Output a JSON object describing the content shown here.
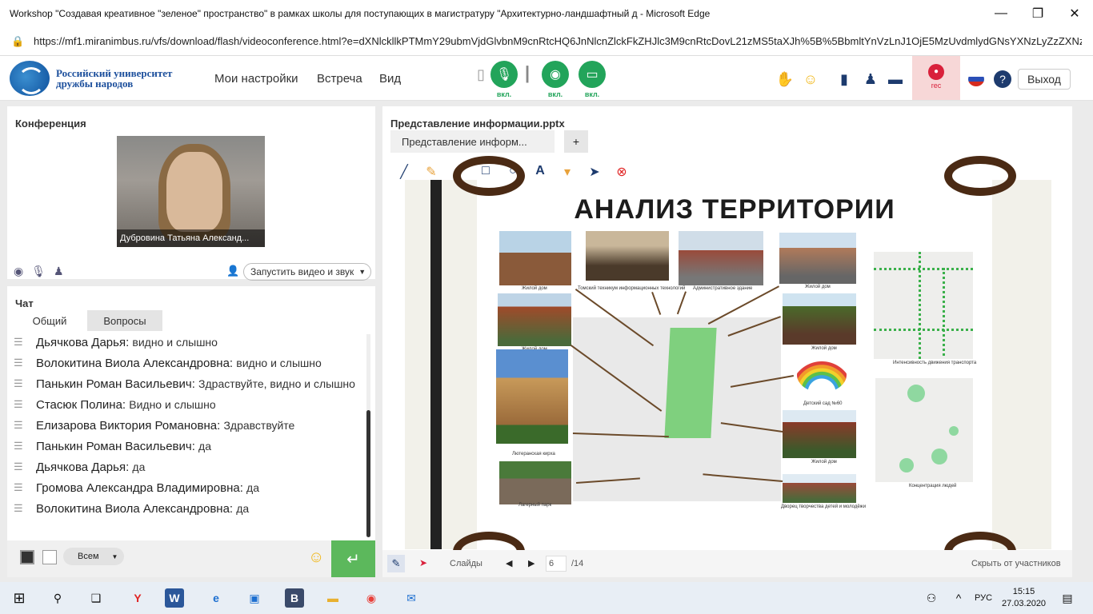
{
  "window": {
    "title": "Workshop \"Создавая креативное \"зеленое\" пространство\" в рамках школы для поступающих в магистратуру \"Архитектурно-ландшафтный д - Microsoft Edge",
    "url": "https://mf1.miranimbus.ru/vfs/download/flash/videoconference.html?e=dXNlckllkPTMmY29ubmVjdGlvbnM9cnRtcHQ6JnNlcnZlckFkZHJlc3M9cnRtcDovL21zMS5taXJh%5B%5BbmltYnVzLnJ1OjE5MzUvdmlydGNsYXNzLyZzZXNzaW9uS"
  },
  "app": {
    "logo_line1": "Российский университет",
    "logo_line2": "дружбы народов",
    "menu": [
      "Мои настройки",
      "Встреча",
      "Вид"
    ],
    "mic_label": "вкл.",
    "cam_label": "вкл.",
    "screen_label": "вкл.",
    "rec_label": "rec",
    "exit_label": "Выход"
  },
  "conference": {
    "title": "Конференция",
    "participant_name": "Дубровина Татьяна Александ...",
    "start_button": "Запустить видео и звук"
  },
  "chat": {
    "title": "Чат",
    "tabs": [
      "Общий",
      "Вопросы"
    ],
    "messages": [
      {
        "name": "Дьячкова Дарья:",
        "text": "видно и слышно"
      },
      {
        "name": "Волокитина Виола Александровна:",
        "text": "видно и слышно"
      },
      {
        "name": "Панькин Роман Васильевич:",
        "text": "Здраствуйте, видно и слышно"
      },
      {
        "name": "Стасюк Полина:",
        "text": "Видно и слышно"
      },
      {
        "name": "Елизарова  Виктория  Романовна:",
        "text": "Здравствуйте"
      },
      {
        "name": "Панькин Роман Васильевич:",
        "text": "да"
      },
      {
        "name": "Дьячкова Дарья:",
        "text": "да"
      },
      {
        "name": "Громова Александра  Владимировна:",
        "text": "да"
      },
      {
        "name": "Волокитина Виола Александровна:",
        "text": "да"
      }
    ],
    "recipient": "Всем"
  },
  "presentation": {
    "title": "Представление информации.pptx",
    "tab_label": "Представление информ...",
    "add_tab": "+",
    "slide_title": "АНАЛИЗ ТЕРРИТОРИИ",
    "captions": {
      "c1": "Жилой дом",
      "c2": "Томский техникум информационных технологий",
      "c3": "Административное здание",
      "c4": "Жилой дом",
      "c5": "Жилой дом",
      "c6": "Жилой дом",
      "c7": "Детский сад №60",
      "c8": "Лютеранская кирха",
      "c9": "Жилой дом",
      "c10": "Лагерный парк",
      "c11": "Дворец творчества детей и молодёжи",
      "c12": "Интенсивность движения транспорта",
      "c13": "Концентрация людей"
    },
    "slides_label": "Слайды",
    "current_slide": "6",
    "total_slides": "/14",
    "hide_label": "Скрыть от участников"
  },
  "taskbar": {
    "lang": "РУС",
    "time": "15:15",
    "date": "27.03.2020"
  }
}
